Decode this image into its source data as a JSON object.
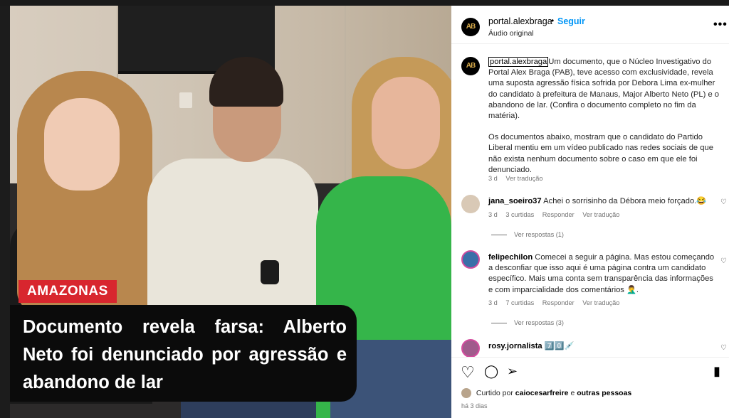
{
  "media": {
    "tag": "AMAZONAS",
    "headline": "Documento revela farsa: Alberto Neto foi denunciado por agressão e abandono de lar"
  },
  "header": {
    "avatar_text": "AB",
    "username": "portal.alexbraga",
    "separator": "•",
    "follow_label": "Seguir",
    "audio": "Áudio original",
    "more_icon": "•••"
  },
  "caption": {
    "username": "portal.alexbraga",
    "text1": "Um documento, que o Núcleo Investigativo do Portal Alex Braga (PAB), teve acesso com exclusividade, revela uma suposta agressão física sofrida por Debora Lima ex-mulher do candidato à prefeitura de Manaus, Major Alberto Neto (PL) e o abandono de lar. (Confira o documento completo no fim da matéria).",
    "text2": "Os documentos abaixo, mostram que o candidato do Partido Liberal mentiu em um vídeo publicado nas redes sociais de que não exista nenhum documento sobre o caso em que ele foi denunciado.",
    "time": "3 d",
    "translate": "Ver tradução"
  },
  "comments": [
    {
      "username": "jana_soeiro37",
      "text": "Achei o sorrisinho da Débora meio forçado.😂",
      "time": "3 d",
      "likes": "3 curtidas",
      "reply": "Responder",
      "translate": "Ver tradução",
      "replies": "Ver respostas (1)"
    },
    {
      "username": "felipechilon",
      "text": "Comecei a seguir a página. Mas estou começando a desconfiar que isso aqui é uma página contra um candidato específico. Mais uma conta sem transparência das informações e com imparcialidade dos comentários 🤦‍♂️.",
      "time": "3 d",
      "likes": "7 curtidas",
      "reply": "Responder",
      "translate": "Ver tradução",
      "replies": "Ver respostas (3)"
    },
    {
      "username": "rosy.jornalista",
      "text": "7️⃣0️⃣💉"
    }
  ],
  "footer": {
    "liked_prefix": "Curtido por",
    "liked_user": "caiocesarfreire",
    "liked_and": "e",
    "liked_others": "outras pessoas",
    "time": "há 3 dias"
  },
  "icons": {
    "heart": "♡",
    "comment": "◯",
    "share": "➢",
    "bookmark": "▮"
  }
}
